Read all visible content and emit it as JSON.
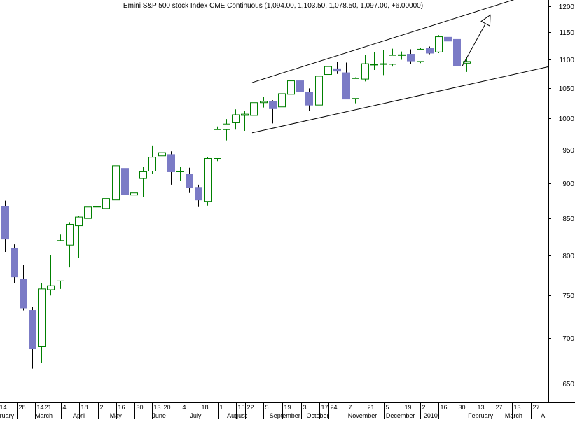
{
  "chart_data": {
    "type": "candlestick",
    "title": "Emini S&P 500 stock Index CME Continuous (1,094.00, 1,103.50, 1,078.50, 1,097.00, +6.00000)",
    "xlabel": "",
    "ylabel": "",
    "scale": "log",
    "ylim": [
      630,
      1215
    ],
    "yticks": [
      650,
      700,
      750,
      800,
      850,
      900,
      950,
      1000,
      1050,
      1100,
      1150,
      1200
    ],
    "grid": false,
    "colors": {
      "up_outline": "#008000",
      "down_fill": "#7b7bc6",
      "line": "#000000",
      "axis": "#000000"
    },
    "candles": [
      {
        "o": 867,
        "h": 875,
        "l": 805,
        "c": 822
      },
      {
        "o": 810,
        "h": 815,
        "l": 765,
        "c": 773
      },
      {
        "o": 770,
        "h": 788,
        "l": 732,
        "c": 735
      },
      {
        "o": 732,
        "h": 736,
        "l": 666,
        "c": 688
      },
      {
        "o": 690,
        "h": 765,
        "l": 672,
        "c": 758
      },
      {
        "o": 757,
        "h": 801,
        "l": 750,
        "c": 762
      },
      {
        "o": 768,
        "h": 828,
        "l": 758,
        "c": 820
      },
      {
        "o": 814,
        "h": 845,
        "l": 785,
        "c": 842
      },
      {
        "o": 840,
        "h": 854,
        "l": 797,
        "c": 852
      },
      {
        "o": 850,
        "h": 870,
        "l": 833,
        "c": 866
      },
      {
        "o": 866,
        "h": 871,
        "l": 825,
        "c": 867
      },
      {
        "o": 864,
        "h": 882,
        "l": 838,
        "c": 878
      },
      {
        "o": 876,
        "h": 930,
        "l": 875,
        "c": 926
      },
      {
        "o": 922,
        "h": 929,
        "l": 878,
        "c": 884
      },
      {
        "o": 883,
        "h": 889,
        "l": 878,
        "c": 886
      },
      {
        "o": 907,
        "h": 924,
        "l": 880,
        "c": 917
      },
      {
        "o": 918,
        "h": 957,
        "l": 914,
        "c": 939
      },
      {
        "o": 941,
        "h": 957,
        "l": 935,
        "c": 946
      },
      {
        "o": 943,
        "h": 948,
        "l": 898,
        "c": 917
      },
      {
        "o": 918,
        "h": 924,
        "l": 903,
        "c": 918
      },
      {
        "o": 913,
        "h": 923,
        "l": 886,
        "c": 894
      },
      {
        "o": 894,
        "h": 898,
        "l": 866,
        "c": 876
      },
      {
        "o": 874,
        "h": 939,
        "l": 868,
        "c": 937
      },
      {
        "o": 937,
        "h": 987,
        "l": 933,
        "c": 982
      },
      {
        "o": 982,
        "h": 999,
        "l": 965,
        "c": 991
      },
      {
        "o": 993,
        "h": 1015,
        "l": 982,
        "c": 1006
      },
      {
        "o": 1005,
        "h": 1012,
        "l": 980,
        "c": 1007
      },
      {
        "o": 1005,
        "h": 1030,
        "l": 998,
        "c": 1026
      },
      {
        "o": 1026,
        "h": 1035,
        "l": 1018,
        "c": 1028
      },
      {
        "o": 1028,
        "h": 1030,
        "l": 992,
        "c": 1016
      },
      {
        "o": 1019,
        "h": 1045,
        "l": 1015,
        "c": 1041
      },
      {
        "o": 1040,
        "h": 1071,
        "l": 1033,
        "c": 1063
      },
      {
        "o": 1063,
        "h": 1078,
        "l": 1042,
        "c": 1045
      },
      {
        "o": 1043,
        "h": 1050,
        "l": 1012,
        "c": 1022
      },
      {
        "o": 1022,
        "h": 1075,
        "l": 1016,
        "c": 1071
      },
      {
        "o": 1074,
        "h": 1098,
        "l": 1065,
        "c": 1088
      },
      {
        "o": 1084,
        "h": 1096,
        "l": 1075,
        "c": 1080
      },
      {
        "o": 1077,
        "h": 1095,
        "l": 1040,
        "c": 1032
      },
      {
        "o": 1033,
        "h": 1069,
        "l": 1025,
        "c": 1067
      },
      {
        "o": 1066,
        "h": 1109,
        "l": 1062,
        "c": 1093
      },
      {
        "o": 1092,
        "h": 1114,
        "l": 1082,
        "c": 1092
      },
      {
        "o": 1093,
        "h": 1118,
        "l": 1073,
        "c": 1093
      },
      {
        "o": 1092,
        "h": 1120,
        "l": 1088,
        "c": 1108
      },
      {
        "o": 1108,
        "h": 1115,
        "l": 1100,
        "c": 1109
      },
      {
        "o": 1110,
        "h": 1119,
        "l": 1092,
        "c": 1098
      },
      {
        "o": 1097,
        "h": 1122,
        "l": 1094,
        "c": 1119
      },
      {
        "o": 1121,
        "h": 1124,
        "l": 1110,
        "c": 1112
      },
      {
        "o": 1114,
        "h": 1145,
        "l": 1112,
        "c": 1142
      },
      {
        "o": 1141,
        "h": 1148,
        "l": 1128,
        "c": 1134
      },
      {
        "o": 1137,
        "h": 1149,
        "l": 1088,
        "c": 1090
      },
      {
        "o": 1094,
        "h": 1103.5,
        "l": 1078.5,
        "c": 1097
      }
    ],
    "channel": {
      "upper": [
        [
          1025,
          1060
        ],
        [
          1217,
          1220
        ]
      ],
      "lower": [
        [
          1025,
          977
        ],
        [
          1217,
          1128
        ]
      ]
    },
    "projection_arrow": [
      [
        1050,
        1089
      ],
      [
        1099,
        1183
      ]
    ],
    "x_axis": {
      "day_ticks": [
        {
          "label": "14",
          "week": -0.7
        },
        {
          "label": "28",
          "week": 1.3
        },
        {
          "label": "14",
          "week": 3.3
        },
        {
          "label": "21",
          "week": 4.1
        },
        {
          "label": "4",
          "week": 6.1
        },
        {
          "label": "18",
          "week": 8.1
        },
        {
          "label": "2",
          "week": 10.1
        },
        {
          "label": "16",
          "week": 12.1
        },
        {
          "label": "30",
          "week": 14.1
        },
        {
          "label": "13",
          "week": 16.0
        },
        {
          "label": "20",
          "week": 17.0
        },
        {
          "label": "4",
          "week": 19.1
        },
        {
          "label": "18",
          "week": 21.1
        },
        {
          "label": "1",
          "week": 23.1
        },
        {
          "label": "15",
          "week": 25.1
        },
        {
          "label": "22",
          "week": 26.1
        },
        {
          "label": "5",
          "week": 28.0
        },
        {
          "label": "19",
          "week": 30.1
        },
        {
          "label": "3",
          "week": 32.1
        },
        {
          "label": "17",
          "week": 34.1
        },
        {
          "label": "24",
          "week": 35.1
        },
        {
          "label": "7",
          "week": 37.1
        },
        {
          "label": "21",
          "week": 39.1
        },
        {
          "label": "5",
          "week": 41.1
        },
        {
          "label": "19",
          "week": 43.1
        },
        {
          "label": "2",
          "week": 45.0
        },
        {
          "label": "16",
          "week": 47.0
        },
        {
          "label": "30",
          "week": 49.0
        },
        {
          "label": "13",
          "week": 51.0
        },
        {
          "label": "27",
          "week": 53.0
        },
        {
          "label": "13",
          "week": 55.0
        },
        {
          "label": "27",
          "week": 57.0
        }
      ],
      "month_labels": [
        {
          "label": "February",
          "week": -1.7
        },
        {
          "label": "March",
          "week": 3.3
        },
        {
          "label": "April",
          "week": 7.4
        },
        {
          "label": "May",
          "week": 11.4
        },
        {
          "label": "June",
          "week": 16.0
        },
        {
          "label": "July",
          "week": 20.1
        },
        {
          "label": "August",
          "week": 24.1
        },
        {
          "label": "September",
          "week": 28.7
        },
        {
          "label": "October",
          "week": 32.7
        },
        {
          "label": "November",
          "week": 37.2
        },
        {
          "label": "December",
          "week": 41.3
        },
        {
          "label": "2010",
          "week": 45.4
        },
        {
          "label": "February",
          "week": 50.2
        },
        {
          "label": "March",
          "week": 54.2
        },
        {
          "label": "A",
          "week": 58.1
        }
      ]
    }
  }
}
